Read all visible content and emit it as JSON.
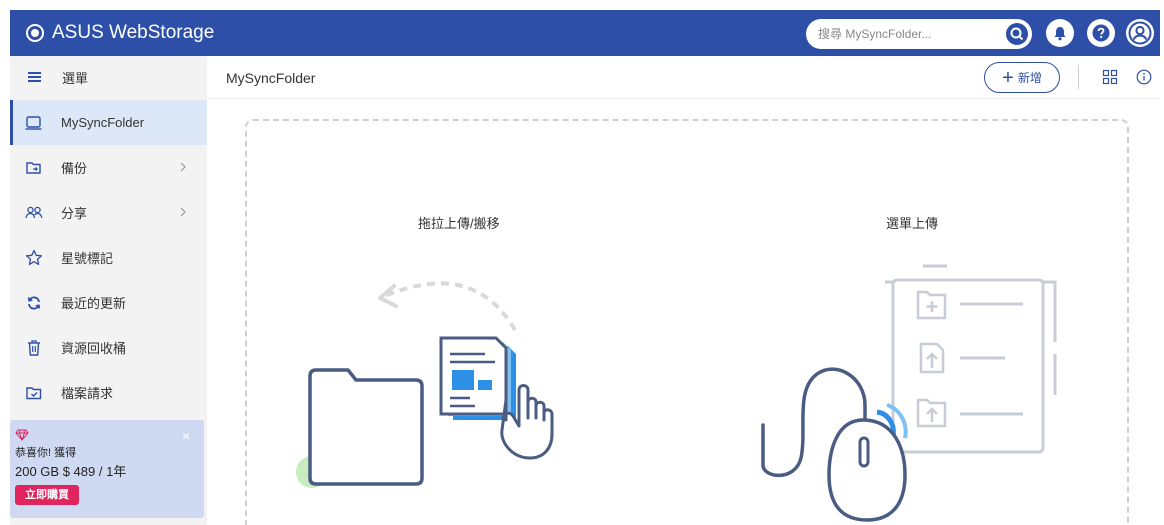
{
  "header": {
    "brand": "ASUS WebStorage",
    "search_placeholder": "搜尋 MySyncFolder..."
  },
  "sidebar": {
    "menu_label": "選單",
    "items": [
      {
        "label": "MySyncFolder",
        "icon": "computer-icon"
      },
      {
        "label": "備份",
        "icon": "backup-folder-icon"
      },
      {
        "label": "分享",
        "icon": "people-icon"
      },
      {
        "label": "星號標記",
        "icon": "star-icon"
      },
      {
        "label": "最近的更新",
        "icon": "refresh-icon"
      },
      {
        "label": "資源回收桶",
        "icon": "trash-icon"
      },
      {
        "label": "檔案請求",
        "icon": "file-request-icon"
      }
    ],
    "promo": {
      "line1": "恭喜你! 獲得",
      "line2": "200 GB $ 489 / 1年",
      "button": "立即購買",
      "close": "×"
    }
  },
  "main": {
    "folder_title": "MySyncFolder",
    "new_button": "新增",
    "drag_label": "拖拉上傳/搬移",
    "menu_upload_label": "選單上傳"
  },
  "colors": {
    "brand": "#2d4fa8",
    "sidebar_bg": "#f3f3f3",
    "active_bg": "#dce7f7",
    "promo_bg": "#cfdaf2",
    "buy_button": "#e0245e",
    "illustration_accent": "#2e8fe6"
  }
}
